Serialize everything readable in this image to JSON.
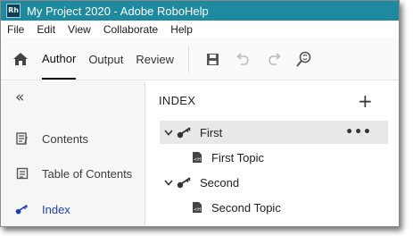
{
  "window": {
    "title": "My Project 2020 - Adobe RoboHelp",
    "app_badge": "Rh"
  },
  "menu": [
    "File",
    "Edit",
    "View",
    "Collaborate",
    "Help"
  ],
  "toolbar": {
    "tabs": [
      {
        "label": "Author",
        "active": true
      },
      {
        "label": "Output",
        "active": false
      },
      {
        "label": "Review",
        "active": false
      }
    ],
    "icons": [
      "home-icon",
      "save-icon",
      "undo-icon",
      "redo-icon",
      "find-replace-icon"
    ]
  },
  "sidebar": {
    "collapse_glyph": "«",
    "items": [
      {
        "label": "Contents",
        "icon": "contents-icon",
        "active": false
      },
      {
        "label": "Table of Contents",
        "icon": "toc-icon",
        "active": false
      },
      {
        "label": "Index",
        "icon": "key-icon",
        "active": true
      }
    ],
    "active_color": "#1f3fbf"
  },
  "index_panel": {
    "heading": "INDEX",
    "add_glyph": "+",
    "more_glyph": "•••",
    "entries": [
      {
        "keyword": "First",
        "selected": true,
        "topics": [
          "First Topic"
        ]
      },
      {
        "keyword": "Second",
        "selected": false,
        "topics": [
          "Second Topic"
        ]
      }
    ]
  },
  "colors": {
    "titlebar": "#1e8aa0",
    "selection": "#e8e8e8"
  }
}
